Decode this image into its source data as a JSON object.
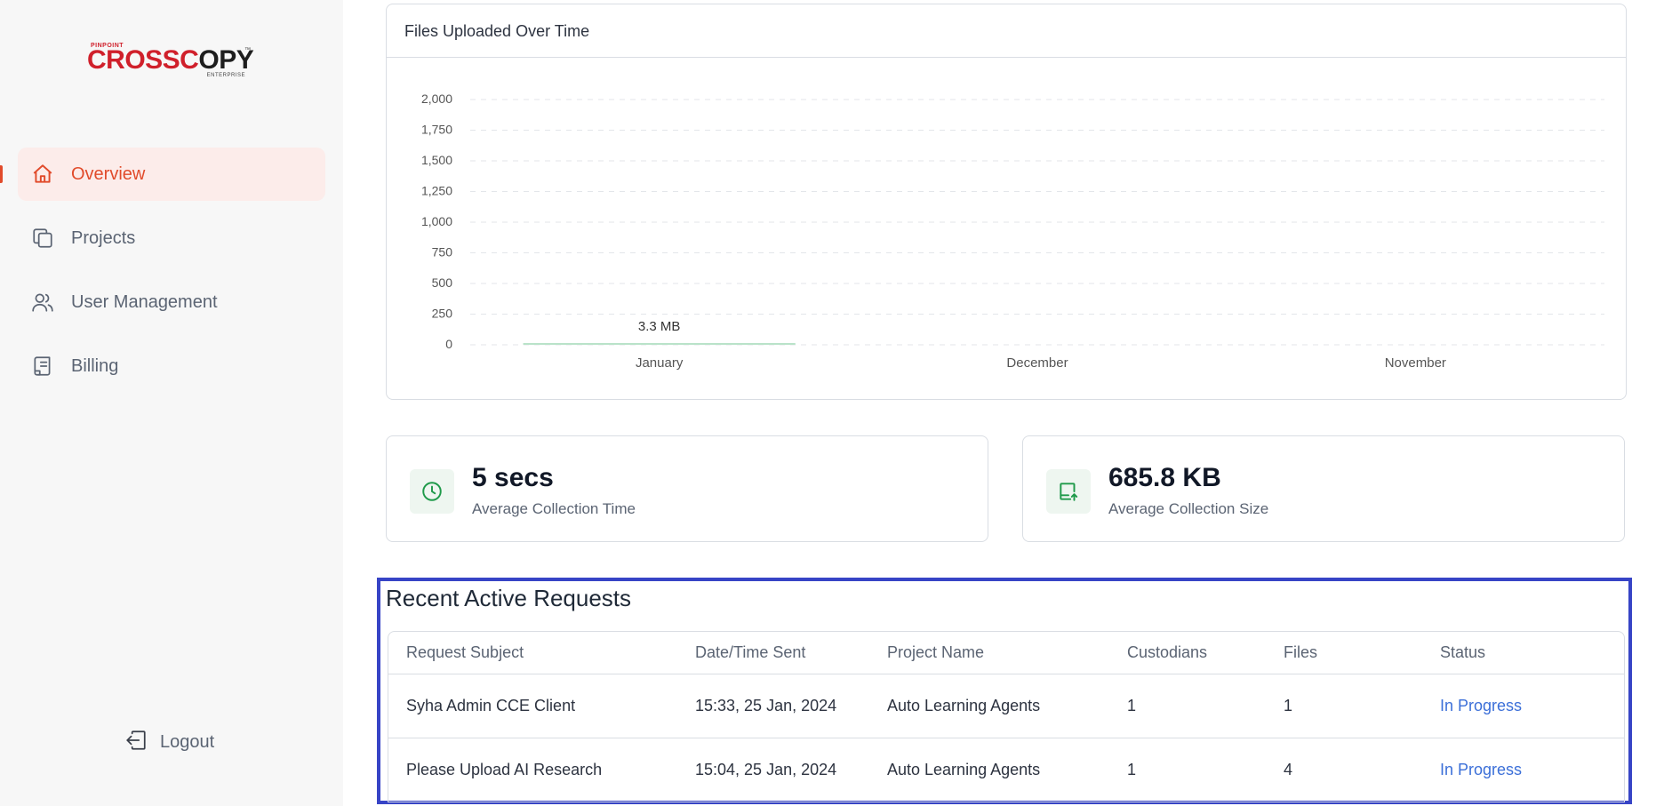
{
  "brand": {
    "tagline_top": "PINPOINT",
    "name_red": "CROSSC",
    "name_dark": "PY",
    "trademark": "™",
    "tagline_bottom": "ENTERPRISE"
  },
  "sidebar": {
    "items": [
      {
        "label": "Overview",
        "icon": "home-icon",
        "active": true
      },
      {
        "label": "Projects",
        "icon": "projects-icon",
        "active": false
      },
      {
        "label": "User Management",
        "icon": "users-icon",
        "active": false
      },
      {
        "label": "Billing",
        "icon": "billing-icon",
        "active": false
      }
    ],
    "logout_label": "Logout"
  },
  "chart": {
    "title": "Files Uploaded Over Time",
    "chart_data": {
      "type": "bar",
      "categories": [
        "January",
        "December",
        "November"
      ],
      "values": [
        3.3,
        0,
        0
      ],
      "value_labels": [
        "3.3 MB",
        "",
        ""
      ],
      "y_ticks": [
        "0",
        "250",
        "500",
        "750",
        "1,000",
        "1,250",
        "1,500",
        "1,750",
        "2,000"
      ],
      "ylim": [
        0,
        2000
      ],
      "grid": true,
      "bar_color": "#b9e3c9"
    }
  },
  "stats": [
    {
      "value": "5 secs",
      "label": "Average Collection Time",
      "icon": "clock-icon"
    },
    {
      "value": "685.8 KB",
      "label": "Average Collection Size",
      "icon": "upload-icon"
    }
  ],
  "requests": {
    "title": "Recent Active Requests",
    "columns": [
      "Request Subject",
      "Date/Time Sent",
      "Project Name",
      "Custodians",
      "Files",
      "Status"
    ],
    "rows": [
      [
        "Syha Admin CCE Client",
        "15:33, 25 Jan, 2024",
        "Auto Learning Agents",
        "1",
        "1",
        "In Progress"
      ],
      [
        "Please Upload AI Research",
        "15:04, 25 Jan, 2024",
        "Auto Learning Agents",
        "1",
        "4",
        "In Progress"
      ]
    ]
  },
  "colors": {
    "accent": "#e14b2b",
    "status_link": "#3b6fd8",
    "highlight_border": "#3744c6"
  }
}
